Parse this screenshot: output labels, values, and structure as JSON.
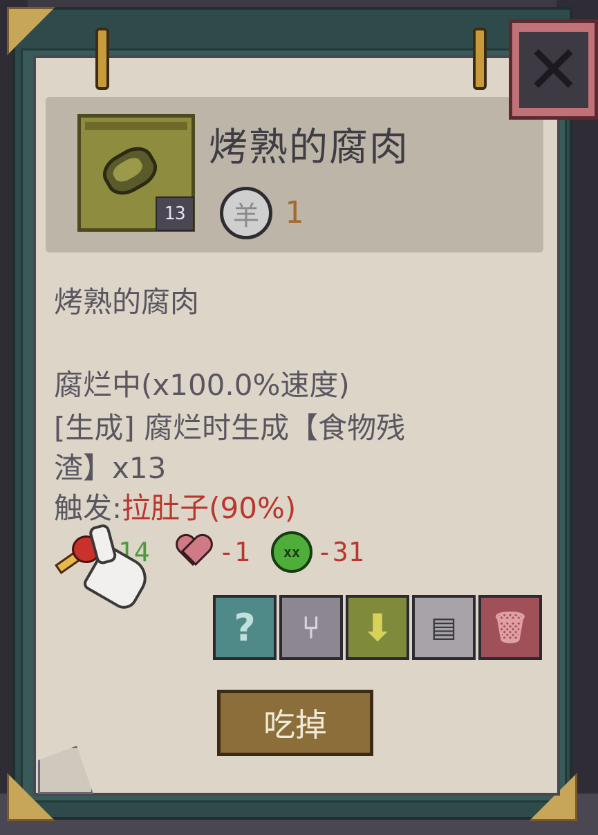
{
  "item": {
    "name": "烤熟的腐肉",
    "count": "13",
    "price": "1",
    "coin_symbol": "羊"
  },
  "description": {
    "name": "烤熟的腐肉",
    "rotting": "腐烂中(x100.0%速度)",
    "generate_line1": "[生成] 腐烂时生成【食物残",
    "generate_line2": "渣】x13",
    "trigger_label": "触发:",
    "trigger_effect": "拉肚子(90%)"
  },
  "stats": [
    {
      "icon": "meat-icon",
      "value": "+14",
      "color": "#4f9a3f"
    },
    {
      "icon": "heart-icon",
      "value": "-1",
      "color": "#b8372f"
    },
    {
      "icon": "sick-face-icon",
      "value": "-31",
      "color": "#b8372f"
    }
  ],
  "actions": {
    "help": "?",
    "split": "⑂",
    "drop": "⬇",
    "note": "▤",
    "trash": "🗑"
  },
  "eat_label": "吃掉",
  "close_symbol": "✕"
}
